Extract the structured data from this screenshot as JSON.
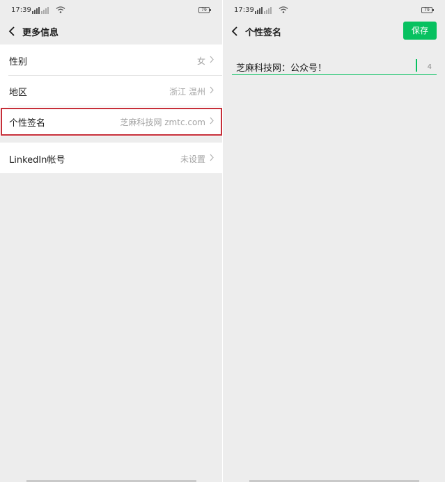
{
  "left": {
    "status_bar": {
      "time": "17:39",
      "battery": "79"
    },
    "nav": {
      "title": "更多信息"
    },
    "rows": [
      {
        "label": "性别",
        "value": "女"
      },
      {
        "label": "地区",
        "value": "浙江 温州"
      },
      {
        "label": "个性签名",
        "value": "芝麻科技网 zmtc.com"
      }
    ],
    "linkedin": {
      "label": "LinkedIn帐号",
      "value": "未设置"
    }
  },
  "right": {
    "status_bar": {
      "time": "17:39",
      "battery": "79"
    },
    "nav": {
      "title": "个性签名",
      "save_label": "保存"
    },
    "editor": {
      "value": "芝麻科技网：公众号！",
      "remaining": "4"
    }
  },
  "colors": {
    "accent": "#07c160",
    "highlight": "#c62e38",
    "background": "#ededed"
  },
  "icons": [
    "back-icon",
    "chevron-right-icon",
    "signal-icon",
    "wifi-icon",
    "battery-icon"
  ]
}
